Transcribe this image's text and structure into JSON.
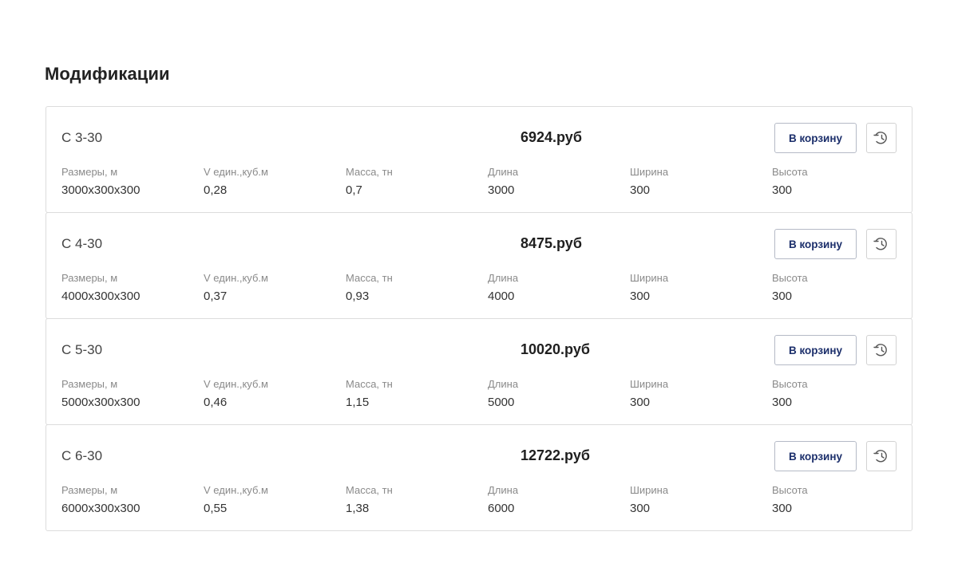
{
  "section_title": "Модификации",
  "icons": {
    "history": "history-clock-icon"
  },
  "colors": {
    "cart_button_text": "#1c2f6b",
    "border": "#dcdcdc"
  },
  "spec_labels": [
    "Размеры, м",
    "V един.,куб.м",
    "Масса, тн",
    "Длина",
    "Ширина",
    "Высота"
  ],
  "modifications": [
    {
      "name": "С 3-30",
      "price": "6924.руб",
      "cart_label": "В корзину",
      "specs": [
        "3000х300х300",
        "0,28",
        "0,7",
        "3000",
        "300",
        "300"
      ]
    },
    {
      "name": "С 4-30",
      "price": "8475.руб",
      "cart_label": "В корзину",
      "specs": [
        "4000х300х300",
        "0,37",
        "0,93",
        "4000",
        "300",
        "300"
      ]
    },
    {
      "name": "С 5-30",
      "price": "10020.руб",
      "cart_label": "В корзину",
      "specs": [
        "5000х300х300",
        "0,46",
        "1,15",
        "5000",
        "300",
        "300"
      ]
    },
    {
      "name": "С 6-30",
      "price": "12722.руб",
      "cart_label": "В корзину",
      "specs": [
        "6000х300х300",
        "0,55",
        "1,38",
        "6000",
        "300",
        "300"
      ]
    }
  ]
}
